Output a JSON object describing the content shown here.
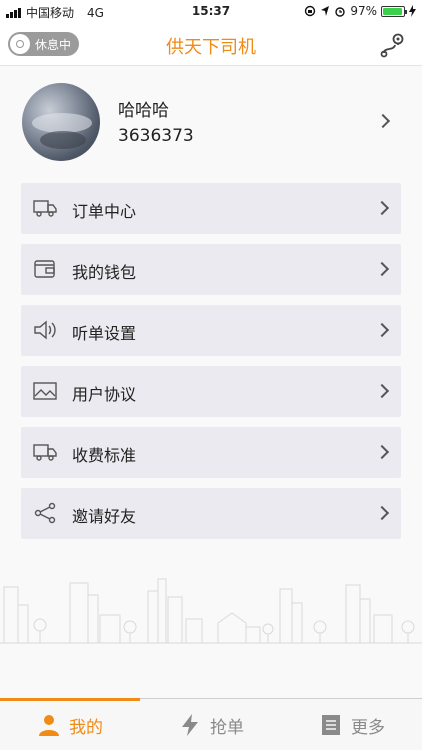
{
  "status_bar": {
    "carrier": "中国移动",
    "network": "4G",
    "time": "15:37",
    "battery_percent": "97%",
    "battery_level": 0.97
  },
  "nav": {
    "status_toggle_label": "休息中",
    "title": "供天下司机",
    "route_icon": "route-map-icon"
  },
  "profile": {
    "name": "哈哈哈",
    "phone": "3636373"
  },
  "menu": [
    {
      "label": "订单中心",
      "icon": "truck-icon"
    },
    {
      "label": "我的钱包",
      "icon": "wallet-icon"
    },
    {
      "label": "听单设置",
      "icon": "speaker-icon"
    },
    {
      "label": "用户协议",
      "icon": "image-icon"
    },
    {
      "label": "收费标准",
      "icon": "truck-icon"
    },
    {
      "label": "邀请好友",
      "icon": "share-icon"
    }
  ],
  "tabs": [
    {
      "label": "我的",
      "icon": "user-icon",
      "active": true
    },
    {
      "label": "抢单",
      "icon": "lightning-icon",
      "active": false
    },
    {
      "label": "更多",
      "icon": "list-icon",
      "active": false
    }
  ],
  "colors": {
    "accent": "#f08b16",
    "menu_bg": "#ebeaf0",
    "toggle_bg": "#9b9b9b",
    "inactive_tab": "#8a8a8a"
  }
}
